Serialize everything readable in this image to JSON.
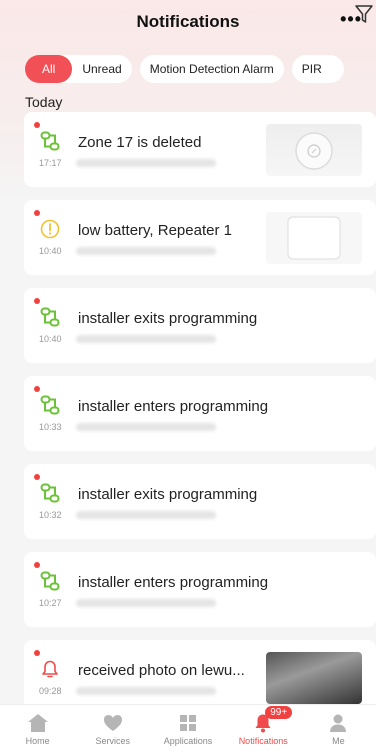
{
  "header": {
    "title": "Notifications",
    "more_label": "•••"
  },
  "filters": {
    "all_label": "All",
    "unread_label": "Unread",
    "motion_label": "Motion Detection Alarm",
    "pir_label": "PIR"
  },
  "section": {
    "today_label": "Today"
  },
  "notifications": [
    {
      "title": "Zone 17 is deleted",
      "time": "17:17",
      "icon": "zone-link-icon"
    },
    {
      "title": "low battery, Repeater 1",
      "time": "10:40",
      "icon": "warning-icon"
    },
    {
      "title": "installer exits programming",
      "time": "10:40",
      "icon": "zone-link-icon"
    },
    {
      "title": "installer enters programming",
      "time": "10:33",
      "icon": "zone-link-icon"
    },
    {
      "title": "installer exits programming",
      "time": "10:32",
      "icon": "zone-link-icon"
    },
    {
      "title": "installer enters programming",
      "time": "10:27",
      "icon": "zone-link-icon"
    },
    {
      "title": "received photo on lewu...",
      "time": "09:28",
      "icon": "bell-icon"
    }
  ],
  "tabbar": {
    "home": "Home",
    "services": "Services",
    "applications": "Applications",
    "notifications": "Notifications",
    "me": "Me",
    "badge": "99+"
  },
  "colors": {
    "accent": "#f05056",
    "icon_green": "#6cc13a",
    "icon_yellow": "#f2c230"
  }
}
